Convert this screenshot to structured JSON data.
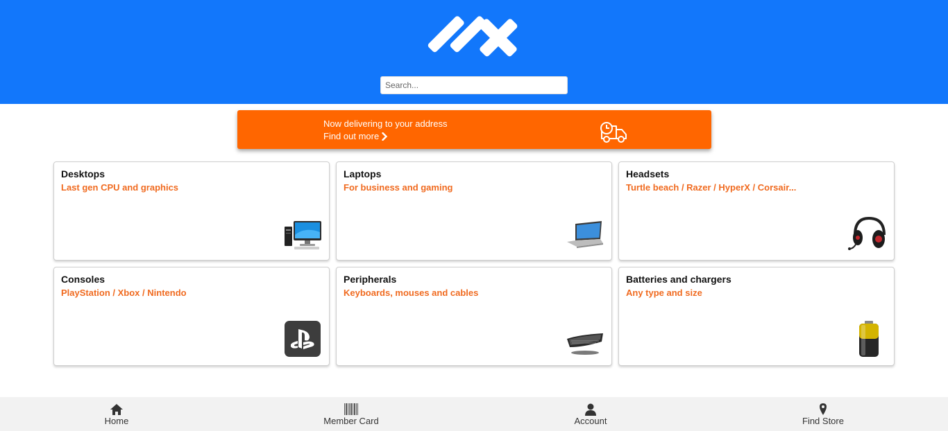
{
  "header": {
    "logo_icon": "ax-logo",
    "brand_color": "#1277fb",
    "search": {
      "placeholder": "Search...",
      "value": ""
    }
  },
  "banner": {
    "line1": "Now delivering to your address",
    "line2": "Find out more",
    "arrow_icon": "chevron-right-icon",
    "truck_icon": "delivery-truck-icon",
    "color": "#ff6600"
  },
  "categories": [
    {
      "title": "Desktops",
      "subtitle": "Last gen CPU and graphics",
      "icon": "desktop-computer-icon"
    },
    {
      "title": "Laptops",
      "subtitle": "For business and gaming",
      "icon": "laptop-icon"
    },
    {
      "title": "Headsets",
      "subtitle": "Turtle beach / Razer / HyperX / Corsair...",
      "icon": "headset-icon"
    },
    {
      "title": "Consoles",
      "subtitle": "PlayStation / Xbox / Nintendo",
      "icon": "playstation-icon"
    },
    {
      "title": "Peripherals",
      "subtitle": "Keyboards, mouses and cables",
      "icon": "keyboard-icon"
    },
    {
      "title": "Batteries and chargers",
      "subtitle": "Any type and size",
      "icon": "battery-icon"
    }
  ],
  "footer": {
    "nav": [
      {
        "label": "Home",
        "icon": "home-icon"
      },
      {
        "label": "Member Card",
        "icon": "barcode-icon"
      },
      {
        "label": "Account",
        "icon": "user-icon"
      },
      {
        "label": "Find Store",
        "icon": "map-pin-icon"
      }
    ]
  }
}
